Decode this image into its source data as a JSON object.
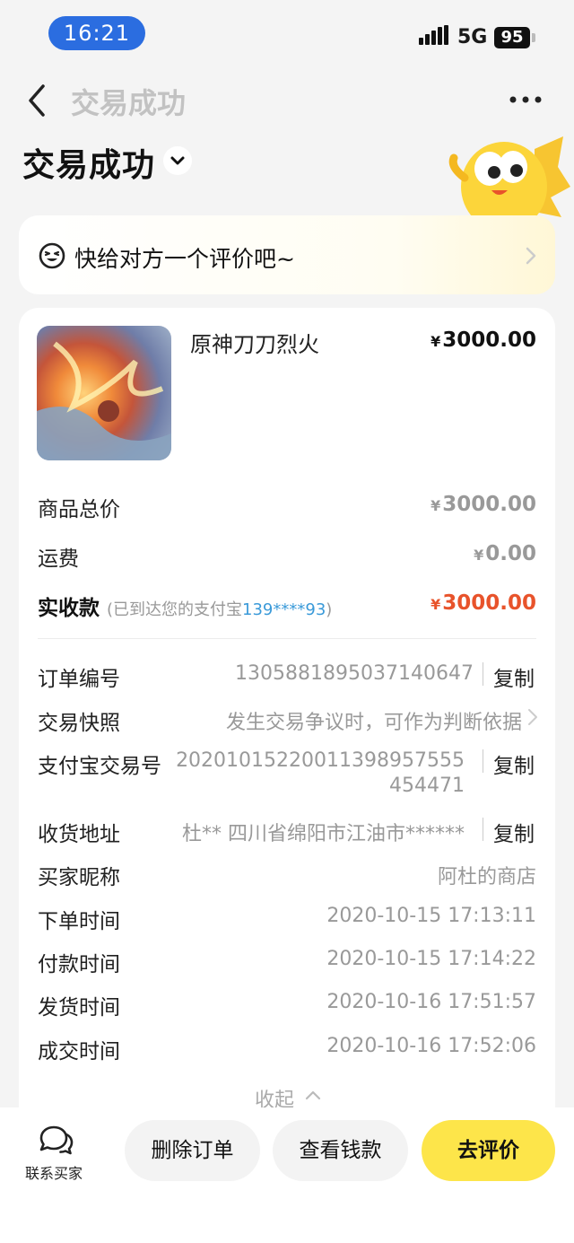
{
  "status": {
    "time": "16:21",
    "network": "5G",
    "battery": "95"
  },
  "nav": {
    "title": "交易成功"
  },
  "header": {
    "title": "交易成功"
  },
  "review": {
    "text": "快给对方一个评价吧~"
  },
  "product": {
    "name": "原神刀刀烈火",
    "price_symbol": "¥",
    "price": "3000.00"
  },
  "summary": {
    "total_label": "商品总价",
    "total_symbol": "¥",
    "total_value": "3000.00",
    "shipping_label": "运费",
    "shipping_symbol": "¥",
    "shipping_value": "0.00",
    "paid_label": "实收款",
    "paid_note_prefix": "(已到达您的支付宝",
    "paid_account": "139****93",
    "paid_note_suffix": ")",
    "paid_symbol": "¥",
    "paid_value": "3000.00"
  },
  "details": {
    "order_no_label": "订单编号",
    "order_no": "1305881895037140647",
    "snapshot_label": "交易快照",
    "snapshot_value": "发生交易争议时，可作为判断依据",
    "alipay_no_label": "支付宝交易号",
    "alipay_no_line1": "20201015220011398957555",
    "alipay_no_line2": "454471",
    "address_label": "收货地址",
    "address_value": "杜** 四川省绵阳市江油市******",
    "buyer_label": "买家昵称",
    "buyer_value": "阿杜的商店",
    "order_time_label": "下单时间",
    "order_time": "2020-10-15 17:13:11",
    "pay_time_label": "付款时间",
    "pay_time": "2020-10-15 17:14:22",
    "ship_time_label": "发货时间",
    "ship_time": "2020-10-16 17:51:57",
    "deal_time_label": "成交时间",
    "deal_time": "2020-10-16 17:52:06",
    "copy_label": "复制",
    "collapse_label": "收起"
  },
  "bottom": {
    "contact_label": "联系买家",
    "delete_label": "删除订单",
    "money_label": "查看钱款",
    "review_label": "去评价"
  },
  "colors": {
    "accent_yellow": "#fde54a",
    "price_red": "#e8532b",
    "link_blue": "#3a9ad9",
    "time_pill_blue": "#2b6de0"
  }
}
